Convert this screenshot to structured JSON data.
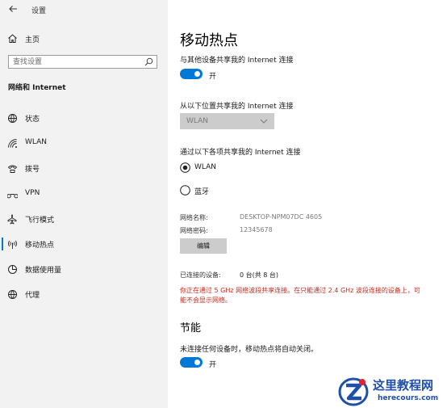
{
  "window": {
    "title": "设置"
  },
  "sidebar": {
    "home_label": "主页",
    "search_placeholder": "查找设置",
    "section_title": "网络和 Internet",
    "items": [
      {
        "label": "状态",
        "icon": "globe-icon"
      },
      {
        "label": "WLAN",
        "icon": "wifi-icon"
      },
      {
        "label": "拨号",
        "icon": "phone-icon"
      },
      {
        "label": "VPN",
        "icon": "vpn-icon"
      },
      {
        "label": "飞行模式",
        "icon": "airplane-icon"
      },
      {
        "label": "移动热点",
        "icon": "hotspot-icon",
        "selected": true
      },
      {
        "label": "数据使用量",
        "icon": "pie-chart-icon"
      },
      {
        "label": "代理",
        "icon": "globe-icon"
      }
    ]
  },
  "main": {
    "title": "移动热点",
    "share_heading": "与其他设备共享我的 Internet 连接",
    "share_toggle_label": "开",
    "share_from_heading": "从以下位置共享我的 Internet 连接",
    "share_from_value": "WLAN",
    "share_via_heading": "通过以下各项共享我的 Internet 连接",
    "share_via_options": [
      {
        "label": "WLAN",
        "checked": true
      },
      {
        "label": "蓝牙",
        "checked": false
      }
    ],
    "network_name_label": "网络名称:",
    "network_name_value": "DESKTOP-NPM07DC 4605",
    "network_password_label": "网络密码:",
    "network_password_value": "12345678",
    "edit_button": "编辑",
    "connected_label": "已连接的设备:",
    "connected_value": "0 台(共 8 台)",
    "warning": "你正在通过 5 GHz 网络波段共享连接。在只能通过 2.4 GHz 波段连接的设备上，可能不会显示网络。",
    "power_heading": "节能",
    "power_desc": "未连接任何设备时，移动热点将自动关闭。",
    "power_toggle_label": "开"
  },
  "colors": {
    "accent": "#0078d7",
    "warning": "#c42b1c",
    "sidebar_bg": "#f2f2f2"
  },
  "watermark": {
    "title": "这里教程网",
    "url": "herecours.com"
  }
}
